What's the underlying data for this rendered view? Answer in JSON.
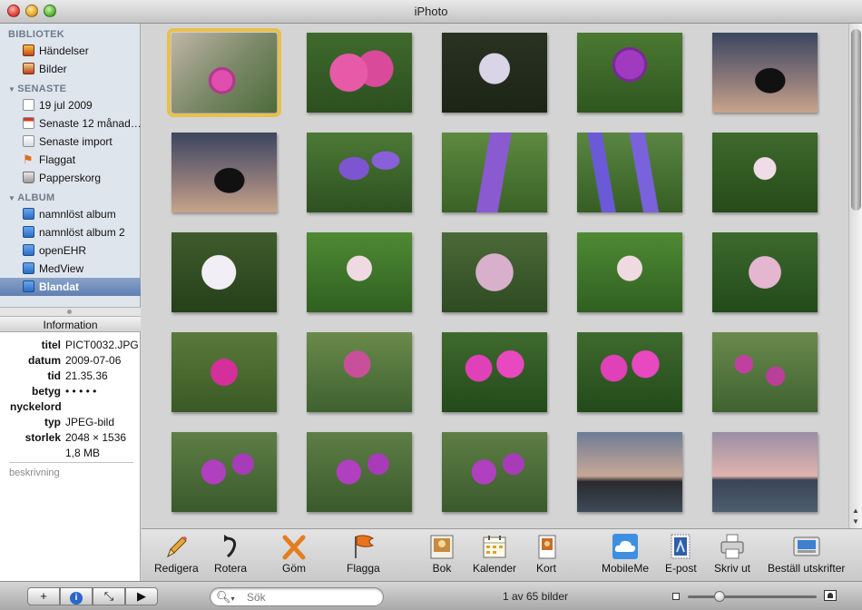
{
  "window": {
    "title": "iPhoto"
  },
  "sidebar": {
    "sections": [
      {
        "label": "BIBLIOTEK",
        "items": [
          {
            "label": "Händelser",
            "icon": "events-icon"
          },
          {
            "label": "Bilder",
            "icon": "photos-icon"
          }
        ]
      },
      {
        "label": "SENASTE",
        "items": [
          {
            "label": "19 jul 2009",
            "icon": "calendar-icon"
          },
          {
            "label": "Senaste 12 månad…",
            "icon": "calendar-12-icon"
          },
          {
            "label": "Senaste import",
            "icon": "import-icon"
          },
          {
            "label": "Flaggat",
            "icon": "flag-icon"
          },
          {
            "label": "Papperskorg",
            "icon": "trash-icon"
          }
        ]
      },
      {
        "label": "ALBUM",
        "items": [
          {
            "label": "namnlöst album",
            "icon": "album-icon"
          },
          {
            "label": "namnlöst album 2",
            "icon": "album-icon"
          },
          {
            "label": "openEHR",
            "icon": "album-icon"
          },
          {
            "label": "MedView",
            "icon": "album-icon"
          },
          {
            "label": "Blandat",
            "icon": "album-icon",
            "selected": true
          }
        ]
      }
    ]
  },
  "info": {
    "header": "Information",
    "fields": [
      {
        "key": "titel",
        "value": "PICT0032.JPG"
      },
      {
        "key": "datum",
        "value": "2009-07-06"
      },
      {
        "key": "tid",
        "value": "21.35.36"
      },
      {
        "key": "betyg",
        "value": "• • • • •"
      },
      {
        "key": "nyckelord",
        "value": ""
      },
      {
        "key": "typ",
        "value": "JPEG-bild"
      },
      {
        "key": "storlek",
        "value": "2048 × 1536"
      },
      {
        "key": "",
        "value": "1,8 MB"
      }
    ],
    "description_placeholder": "beskrivning"
  },
  "photos": [
    {
      "kind": "pink-mallow",
      "selected": true
    },
    {
      "kind": "pink-cluster"
    },
    {
      "kind": "white-umbel-dark"
    },
    {
      "kind": "purple-thistle"
    },
    {
      "kind": "silhouette-sunset"
    },
    {
      "kind": "silhouette-sunset"
    },
    {
      "kind": "bellflower"
    },
    {
      "kind": "vetch"
    },
    {
      "kind": "vetch-blue"
    },
    {
      "kind": "white-clover-green"
    },
    {
      "kind": "white-umbel"
    },
    {
      "kind": "bramble"
    },
    {
      "kind": "pink-lilac"
    },
    {
      "kind": "bramble"
    },
    {
      "kind": "pink-bramble"
    },
    {
      "kind": "red-clover"
    },
    {
      "kind": "red-clover-field"
    },
    {
      "kind": "fireweed"
    },
    {
      "kind": "fireweed"
    },
    {
      "kind": "small-pink-field"
    },
    {
      "kind": "purple-field"
    },
    {
      "kind": "purple-field"
    },
    {
      "kind": "purple-field"
    },
    {
      "kind": "sea-dusk"
    },
    {
      "kind": "sea-dusk-pink"
    }
  ],
  "toolbar": {
    "items": [
      {
        "label": "Redigera",
        "icon": "pencil-icon"
      },
      {
        "label": "Rotera",
        "icon": "rotate-icon"
      },
      {
        "label": "Göm",
        "icon": "hide-x-icon"
      },
      {
        "label": "Flagga",
        "icon": "flag-icon"
      },
      {
        "label": "Bok",
        "icon": "book-icon"
      },
      {
        "label": "Kalender",
        "icon": "calendar-icon"
      },
      {
        "label": "Kort",
        "icon": "card-icon"
      },
      {
        "label": "MobileMe",
        "icon": "cloud-icon"
      },
      {
        "label": "E-post",
        "icon": "stamp-icon"
      },
      {
        "label": "Skriv ut",
        "icon": "printer-icon"
      },
      {
        "label": "Beställ utskrifter",
        "icon": "order-prints-icon"
      }
    ]
  },
  "bottom": {
    "search_placeholder": "Sök",
    "count_text": "1 av 65 bilder",
    "buttons": [
      "+",
      "i",
      "⤡",
      "▶"
    ],
    "zoom_level": 0.22
  },
  "colors": {
    "selection": "#e7c04f",
    "sidebar_bg": "#dfe5ed",
    "sidebar_selected": "#6583b5"
  }
}
